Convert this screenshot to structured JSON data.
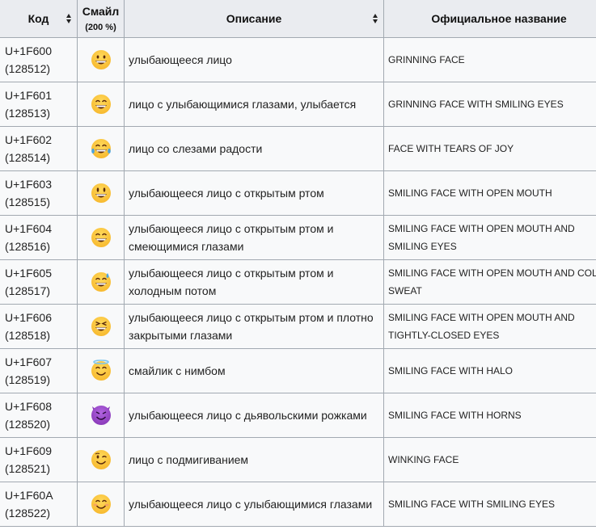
{
  "table": {
    "headers": {
      "code": "Код",
      "emoji": "Смайл",
      "emoji_sub": "(200 %)",
      "description": "Описание",
      "official_name": "Официальное название"
    },
    "rows": [
      {
        "code": "U+1F600",
        "decimal": "(128512)",
        "emoji_icon": "grinning-face",
        "description": "улыбающееся лицо",
        "official_name": "GRINNING FACE"
      },
      {
        "code": "U+1F601",
        "decimal": "(128513)",
        "emoji_icon": "grinning-face-with-smiling-eyes",
        "description": "лицо с улыбающимися глазами, улыбается",
        "official_name": "GRINNING FACE WITH SMILING EYES"
      },
      {
        "code": "U+1F602",
        "decimal": "(128514)",
        "emoji_icon": "face-with-tears-of-joy",
        "description": "лицо со слезами радости",
        "official_name": "FACE WITH TEARS OF JOY"
      },
      {
        "code": "U+1F603",
        "decimal": "(128515)",
        "emoji_icon": "smiling-face-with-open-mouth",
        "description": "улыбающееся лицо с открытым ртом",
        "official_name": "SMILING FACE WITH OPEN MOUTH"
      },
      {
        "code": "U+1F604",
        "decimal": "(128516)",
        "emoji_icon": "smiling-face-with-open-mouth-and-smiling-eyes",
        "description": "улыбающееся лицо с открытым ртом и смеющимися глазами",
        "official_name": "SMILING FACE WITH OPEN MOUTH AND SMILING EYES"
      },
      {
        "code": "U+1F605",
        "decimal": "(128517)",
        "emoji_icon": "smiling-face-with-open-mouth-and-cold-sweat",
        "description": "улыбающееся лицо с открытым ртом и холодным потом",
        "official_name": "SMILING FACE WITH OPEN MOUTH AND COLD SWEAT"
      },
      {
        "code": "U+1F606",
        "decimal": "(128518)",
        "emoji_icon": "smiling-face-with-open-mouth-and-tightly-closed-eyes",
        "description": "улыбающееся лицо с открытым ртом и плотно закрытыми глазами",
        "official_name": "SMILING FACE WITH OPEN MOUTH AND TIGHTLY-CLOSED EYES"
      },
      {
        "code": "U+1F607",
        "decimal": "(128519)",
        "emoji_icon": "smiling-face-with-halo",
        "description": "смайлик с нимбом",
        "official_name": "SMILING FACE WITH HALO"
      },
      {
        "code": "U+1F608",
        "decimal": "(128520)",
        "emoji_icon": "smiling-face-with-horns",
        "description": "улыбающееся лицо с дьявольскими рожками",
        "official_name": "SMILING FACE WITH HORNS"
      },
      {
        "code": "U+1F609",
        "decimal": "(128521)",
        "emoji_icon": "winking-face",
        "description": "лицо с подмигиванием",
        "official_name": "WINKING FACE"
      },
      {
        "code": "U+1F60A",
        "decimal": "(128522)",
        "emoji_icon": "smiling-face-with-smiling-eyes",
        "description": "улыбающееся лицо с улыбающимися глазами",
        "official_name": "SMILING FACE WITH SMILING EYES"
      }
    ]
  },
  "colors": {
    "header_bg": "#eaecf0",
    "cell_bg": "#f8f9fa",
    "border": "#a2a9b1",
    "emoji_yellow": "#f7b92f",
    "emoji_purple": "#8a3ab9"
  }
}
